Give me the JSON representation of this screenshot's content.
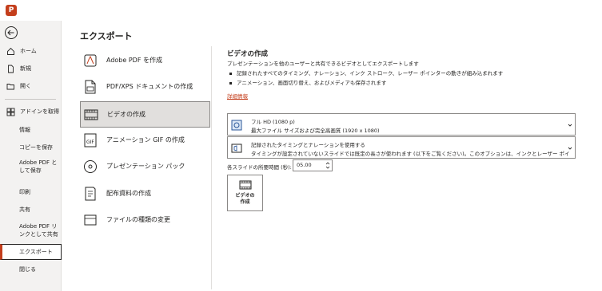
{
  "app": {
    "logo_letter": "P",
    "accent_color": "#c43e1c"
  },
  "sidebar": {
    "items": [
      {
        "label": "ホーム",
        "icon": "home-icon"
      },
      {
        "label": "新規",
        "icon": "new-file-icon"
      },
      {
        "label": "開く",
        "icon": "folder-open-icon"
      },
      {
        "label": "アドインを取得",
        "icon": "grid-icon"
      },
      {
        "label": "情報"
      },
      {
        "label": "コピーを保存"
      },
      {
        "label": "Adobe PDF として保存"
      },
      {
        "label": "印刷"
      },
      {
        "label": "共有"
      },
      {
        "label": "Adobe PDF リンクとして共有"
      },
      {
        "label": "エクスポート",
        "active": true
      },
      {
        "label": "閉じる"
      }
    ]
  },
  "main": {
    "title": "エクスポート",
    "options": [
      {
        "label": "Adobe PDF を作成",
        "icon": "adobe-pdf-icon"
      },
      {
        "label": "PDF/XPS ドキュメントの作成",
        "icon": "pdf-document-icon"
      },
      {
        "label": "ビデオの作成",
        "icon": "video-icon",
        "selected": true
      },
      {
        "label": "アニメーション GIF の作成",
        "icon": "gif-icon"
      },
      {
        "label": "プレゼンテーション パック",
        "icon": "disc-icon"
      },
      {
        "label": "配布資料の作成",
        "icon": "handout-icon"
      },
      {
        "label": "ファイルの種類の変更",
        "icon": "change-file-type-icon"
      }
    ]
  },
  "detail": {
    "title": "ビデオの作成",
    "description": "プレゼンテーションを他のユーザーと共有できるビデオとしてエクスポートします",
    "bullets": [
      "記録されたすべてのタイミング、ナレーション、インク ストローク、レーザー ポインターの動きが組み込まれます",
      "アニメーション、画面切り替え、およびメディアも保存されます"
    ],
    "more_info": "詳細情報",
    "quality": {
      "line1": "フル HD (1080 p)",
      "line2": "最大ファイル サイズおよび完全高画質 (1920 x 1080)"
    },
    "timing": {
      "line1": "記録されたタイミングとナレーションを使用する",
      "line2": "タイミングが設定されていないスライドでは既定の長さが使われます (以下をご覧ください)。このオプションは、インクとレーザー ポインターの..."
    },
    "seconds_label": "各スライドの所要時間 (秒):",
    "seconds_value": "05.00",
    "create_button": "ビデオの\n作成"
  }
}
